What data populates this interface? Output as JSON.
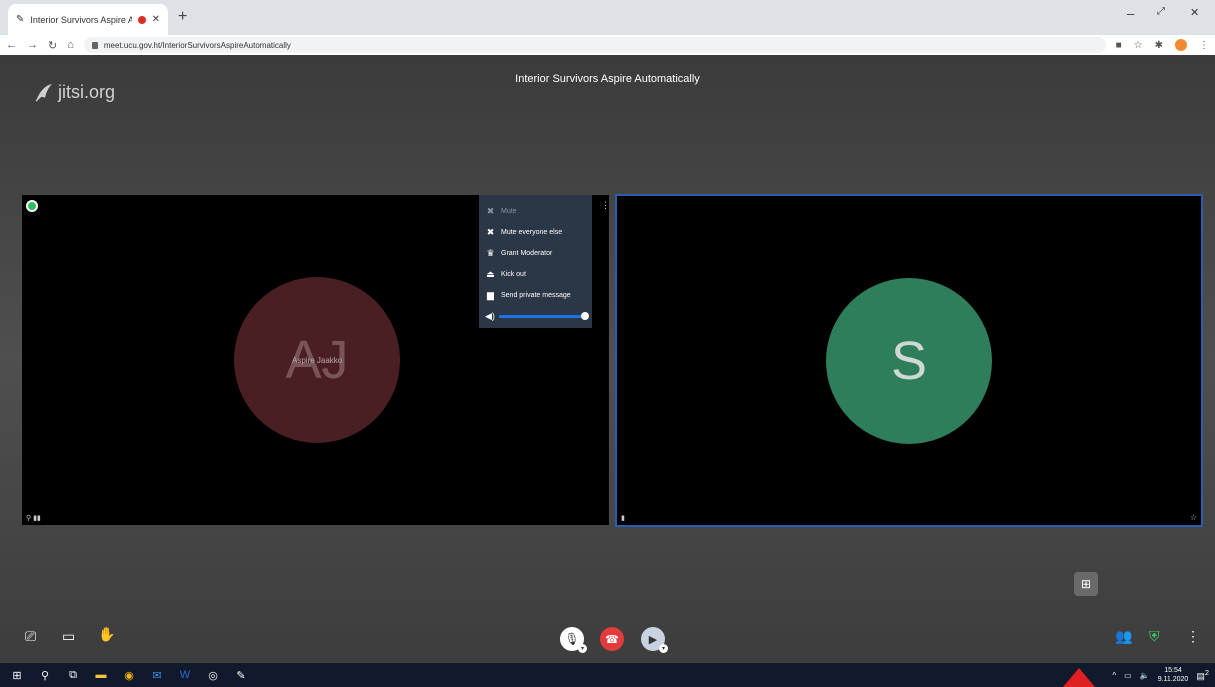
{
  "browser": {
    "tab_title": "Interior Survivors Aspire Aut",
    "new_tab": "+",
    "url": "meet.ucu.gov.ht/InteriorSurvivorsAspireAutomatically",
    "win_min": "–",
    "win_max": "⤢",
    "win_close": "✕"
  },
  "meeting": {
    "logo": "jitsi.org",
    "subject": "Interior Survivors Aspire Automatically"
  },
  "tiles": {
    "left": {
      "initials": "AJ",
      "name": "Aspire Jaakko",
      "status": "⚲ ▮▮"
    },
    "right": {
      "initials": "S",
      "status": "▮",
      "status_right": "☆"
    }
  },
  "popup": {
    "items": [
      {
        "label": "Mute"
      },
      {
        "label": "Mute everyone else"
      },
      {
        "label": "Grant Moderator"
      },
      {
        "label": "Kick out"
      },
      {
        "label": "Send private message"
      }
    ],
    "volume": 1.0
  },
  "taskbar": {
    "time": "15:54",
    "date": "9.11.2020",
    "notif_count": "2"
  },
  "colors": {
    "accent": "#1a73e8",
    "hangup": "#e33b3b",
    "avatar_aj": "#4a1f24",
    "avatar_s": "#2e7d5b",
    "popup_bg": "#2b3647",
    "annotation_arrow": "#e02020"
  }
}
